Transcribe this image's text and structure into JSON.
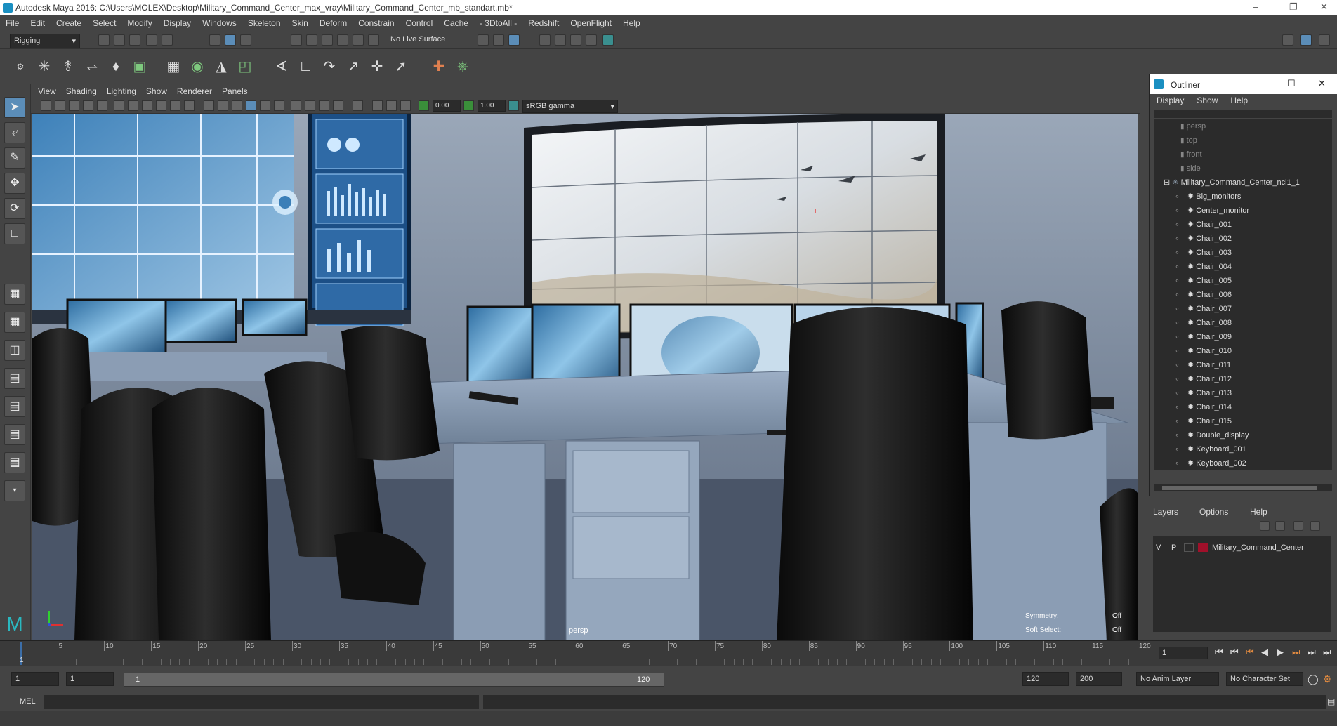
{
  "window": {
    "title": "Autodesk Maya 2016: C:\\Users\\MOLEX\\Desktop\\Military_Command_Center_max_vray\\Military_Command_Center_mb_standart.mb*"
  },
  "menus": [
    "File",
    "Edit",
    "Create",
    "Select",
    "Modify",
    "Display",
    "Windows",
    "Skeleton",
    "Skin",
    "Deform",
    "Constrain",
    "Control",
    "Cache",
    "- 3DtoAll -",
    "Redshift",
    "OpenFlight",
    "Help"
  ],
  "status": {
    "menu_set": "Rigging",
    "live_surface": "No Live Surface"
  },
  "panel": {
    "menus": [
      "View",
      "Shading",
      "Lighting",
      "Show",
      "Renderer",
      "Panels"
    ],
    "exposure": "0.00",
    "gamma": "1.00",
    "color_space": "sRGB gamma",
    "camera_label": "persp",
    "hud": {
      "symmetry_label": "Symmetry:",
      "symmetry_value": "Off",
      "soft_select_label": "Soft Select:",
      "soft_select_value": "Off"
    }
  },
  "timeline": {
    "ticks": [
      "1",
      "5",
      "10",
      "15",
      "20",
      "25",
      "30",
      "35",
      "40",
      "45",
      "50",
      "55",
      "60",
      "65",
      "70",
      "75",
      "80",
      "85",
      "90",
      "95",
      "100",
      "105",
      "110",
      "115",
      "120"
    ],
    "current_frame": "1"
  },
  "range": {
    "start": "1",
    "playback_start": "1",
    "slider_start": "1",
    "slider_end": "120",
    "playback_end": "120",
    "end": "200",
    "anim_layer": "No Anim Layer",
    "character_set": "No Character Set"
  },
  "command": {
    "label": "MEL"
  },
  "outliner": {
    "title": "Outliner",
    "menus": [
      "Display",
      "Show",
      "Help"
    ],
    "cameras": [
      "persp",
      "top",
      "front",
      "side"
    ],
    "root": "Military_Command_Center_ncl1_1",
    "children": [
      "Big_monitors",
      "Center_monitor",
      "Chair_001",
      "Chair_002",
      "Chair_003",
      "Chair_004",
      "Chair_005",
      "Chair_006",
      "Chair_007",
      "Chair_008",
      "Chair_009",
      "Chair_010",
      "Chair_011",
      "Chair_012",
      "Chair_013",
      "Chair_014",
      "Chair_015",
      "Double_display",
      "Keyboard_001",
      "Keyboard_002"
    ]
  },
  "layers": {
    "menus": [
      "Layers",
      "Options",
      "Help"
    ],
    "layer_name": "Military_Command_Center",
    "v": "V",
    "p": "P",
    "layer_color": "#a0102a"
  }
}
